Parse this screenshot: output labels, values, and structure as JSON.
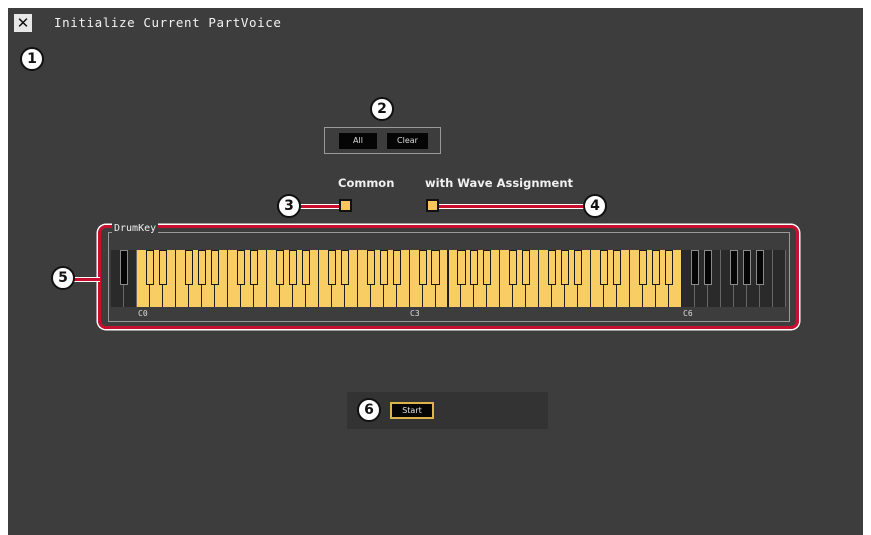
{
  "window": {
    "title": "Initialize Current PartVoice",
    "close_glyph": "✕"
  },
  "callouts": [
    "1",
    "2",
    "3",
    "4",
    "5",
    "6"
  ],
  "selection": {
    "all_label": "All",
    "clear_label": "Clear"
  },
  "options": {
    "common_label": "Common",
    "common_checked": true,
    "wave_label": "with Wave Assignment",
    "wave_checked": true
  },
  "drum_key": {
    "group_label": "DrumKey",
    "octave_labels": [
      "C0",
      "C3",
      "C6"
    ],
    "selected_white_range": "C0–B5",
    "selected_notes": "C0 to B5"
  },
  "actions": {
    "start_label": "Start"
  },
  "colors": {
    "panel_bg": "#3d3d3d",
    "selected_key": "#f8cd63",
    "checkbox": "#f7c55a",
    "highlight_frame": "#c8102e",
    "start_border": "#e0b24a"
  }
}
